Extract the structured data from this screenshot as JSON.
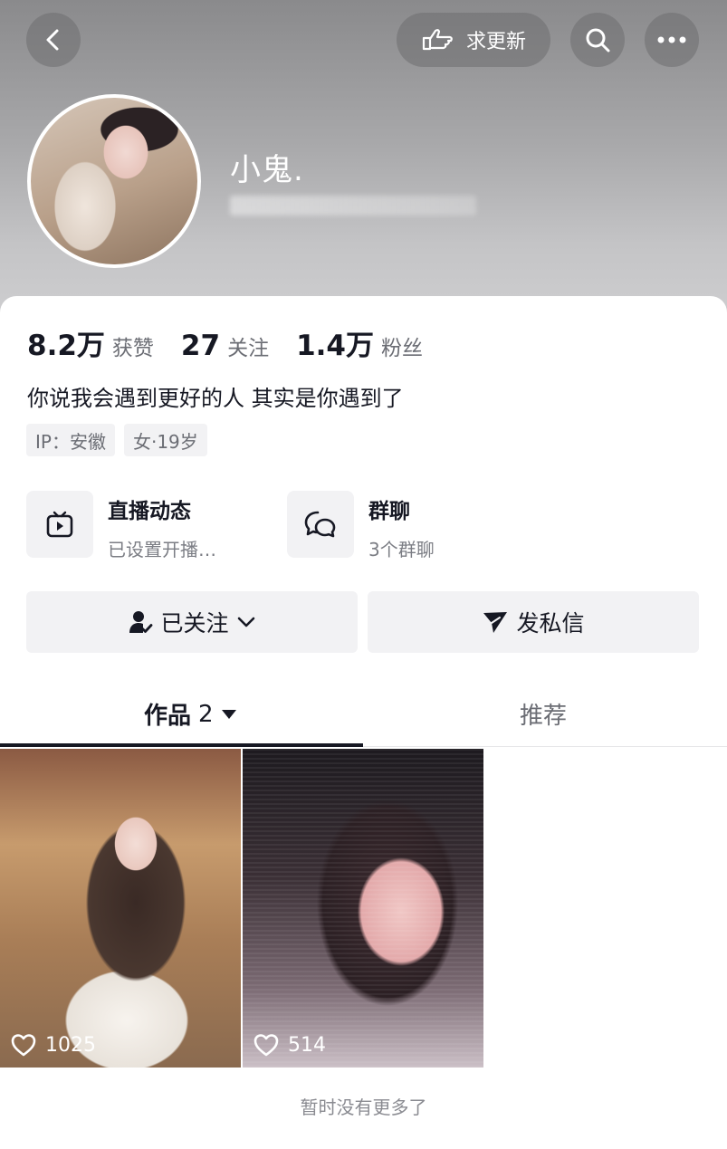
{
  "header": {
    "update_label": "求更新",
    "nickname": "小鬼."
  },
  "stats": [
    {
      "value": "8.2万",
      "label": "获赞"
    },
    {
      "value": "27",
      "label": "关注"
    },
    {
      "value": "1.4万",
      "label": "粉丝"
    }
  ],
  "bio": "你说我会遇到更好的人 其实是你遇到了",
  "tags": [
    "IP：安徽",
    "女·19岁"
  ],
  "entries": {
    "live": {
      "title": "直播动态",
      "subtitle": "已设置开播…"
    },
    "group": {
      "title": "群聊",
      "subtitle": "3个群聊"
    }
  },
  "actions": {
    "follow_label": "已关注",
    "message_label": "发私信"
  },
  "tabs": {
    "works_label": "作品",
    "works_count": "2",
    "recommend_label": "推荐"
  },
  "videos": [
    {
      "likes": "1025"
    },
    {
      "likes": "514"
    }
  ],
  "footer_note": "暂时没有更多了"
}
